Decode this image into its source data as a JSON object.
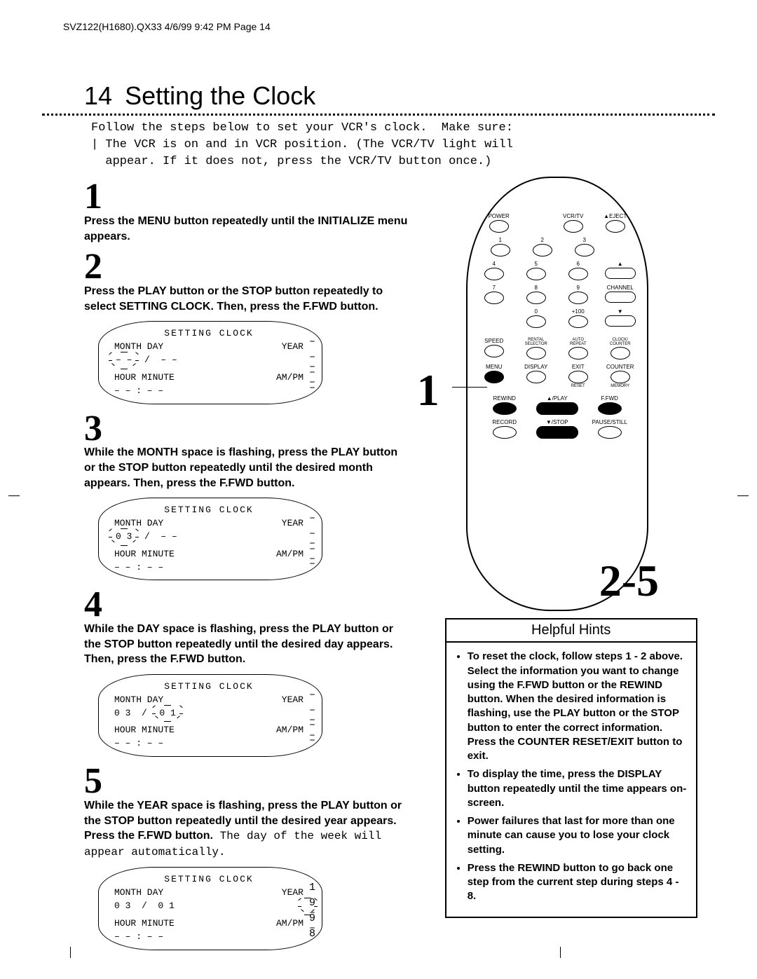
{
  "meta": {
    "header_line": "SVZ122(H1680).QX33  4/6/99  9:42 PM  Page 14"
  },
  "title": {
    "number": "14",
    "text": "Setting the Clock"
  },
  "intro": "Follow the steps below to set your VCR's clock.  Make sure:\n| The VCR is on and in VCR position. (The VCR/TV light will\n  appear. If it does not, press the VCR/TV button once.)",
  "steps": [
    {
      "num": "1",
      "text": "Press the MENU button repeatedly until the INITIALIZE menu appears."
    },
    {
      "num": "2",
      "text": "Press the PLAY button or the STOP button repeatedly to select SETTING CLOCK. Then, press the F.FWD button.",
      "display": {
        "title": "SETTING CLOCK",
        "row1_left": "MONTH DAY",
        "row1_right": "YEAR",
        "val1_left": "– –  /  – –",
        "val1_left_hl": true,
        "hl_field": "month",
        "side1": "– – – –",
        "row2_left": "HOUR MINUTE",
        "row2_right": "AM/PM",
        "val2_left": "– –  :  – –",
        "side2": "– –"
      }
    },
    {
      "num": "3",
      "text": "While the MONTH space is flashing, press the PLAY button or the STOP button repeatedly until the desired month appears. Then, press the F.FWD button.",
      "display": {
        "title": "SETTING CLOCK",
        "row1_left": "MONTH DAY",
        "row1_right": "YEAR",
        "val1_left": "0 3  /  – –",
        "hl_field": "month",
        "side1": "– – – –",
        "row2_left": "HOUR MINUTE",
        "row2_right": "AM/PM",
        "val2_left": "– –  :  – –",
        "side2": "– –"
      }
    },
    {
      "num": "4",
      "text": "While the DAY space is flashing, press the PLAY button or the STOP button repeatedly until the desired day appears. Then, press the F.FWD button.",
      "display": {
        "title": "SETTING CLOCK",
        "row1_left": "MONTH DAY",
        "row1_right": "YEAR",
        "val1_left": "0 3  /  0 1",
        "hl_field": "day",
        "side1": "– – – –",
        "row2_left": "HOUR MINUTE",
        "row2_right": "AM/PM",
        "val2_left": "– –  :  – –",
        "side2": "– –"
      }
    },
    {
      "num": "5",
      "text": "While the YEAR space is flashing, press the PLAY button or the STOP button repeatedly until the desired year appears. Press the F.FWD button.",
      "text_tail_plain": " The day of the week will appear automatically.",
      "display": {
        "title": "SETTING CLOCK",
        "row1_left": "MONTH DAY",
        "row1_right": "YEAR",
        "val1_left": "0 3  /  0 1",
        "hl_field": "year",
        "side1": "1 9 9 8",
        "row2_left": "HOUR MINUTE",
        "row2_right": "AM/PM",
        "val2_left": "– –  :  – –",
        "side2": "– –"
      }
    }
  ],
  "remote": {
    "labels_row1": [
      "POWER",
      "VCR/TV",
      "▲EJECT"
    ],
    "num_rows": [
      [
        "1",
        "2",
        "3"
      ],
      [
        "4",
        "5",
        "6"
      ],
      [
        "7",
        "8",
        "9"
      ],
      [
        "",
        "0",
        "+100"
      ]
    ],
    "channel_label": "CHANNEL",
    "arrows": [
      "▲",
      "▼"
    ],
    "row_small1": [
      "SPEED",
      "RENTAL SELECTOR",
      "AUTO REPEAT",
      "CLOCK/ COUNTER"
    ],
    "row_small2": [
      "MENU",
      "DISPLAY",
      "EXIT",
      "COUNTER"
    ],
    "row_small2_sub": [
      "",
      "",
      "RESET",
      "MEMORY"
    ],
    "row_trans1": [
      "REWIND",
      "▲/PLAY",
      "F.FWD"
    ],
    "row_trans2": [
      "RECORD",
      "▼/STOP",
      "PAUSE/STILL"
    ],
    "ref1": "1",
    "ref25": "2-5"
  },
  "hints": {
    "title": "Helpful Hints",
    "items": [
      "To reset the clock, follow steps 1 - 2 above. Select the information you want to change using the F.FWD button or the REWIND button. When the desired information is flashing, use the PLAY button or the STOP button to enter the correct information. Press the COUNTER RESET/EXIT button to exit.",
      "To display the time, press the DISPLAY button repeatedly until the time appears on-screen.",
      "Power failures that last for more than one minute can cause you to lose your clock setting.",
      "Press the REWIND button to go back one step from the current step during steps 4 - 8."
    ]
  }
}
